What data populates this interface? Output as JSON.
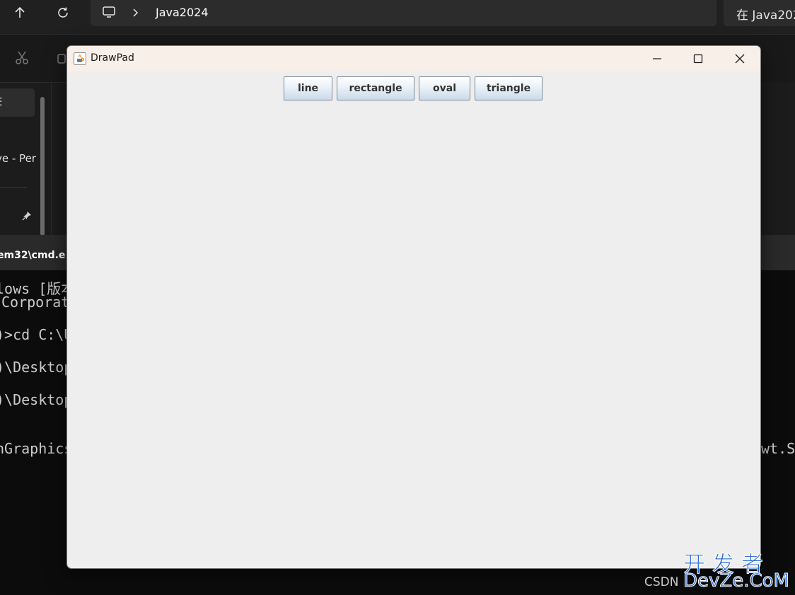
{
  "explorer": {
    "address_path": "Java2024",
    "search_placeholder": "在 Java202",
    "sidebar_text_1": "E",
    "sidebar_text_2": "ve - Per"
  },
  "cmd": {
    "title": "em32\\cmd.e",
    "lines": [
      "lows [版本",
      "Corporat",
      ")>cd C:\\U",
      ")\\Desktop",
      ")\\Desktop",
      "nGraphics"
    ],
    "right_fragment": "wt.Sy"
  },
  "drawpad": {
    "title": "DrawPad",
    "buttons": [
      {
        "label": "line"
      },
      {
        "label": "rectangle"
      },
      {
        "label": "oval"
      },
      {
        "label": "triangle"
      }
    ]
  },
  "watermark": {
    "chinese": "开发者",
    "csdn": "CSDN",
    "site": "DevZe.CoM"
  },
  "colors": {
    "explorer_bg": "#202020",
    "cmd_bg": "#0c0c0c",
    "drawpad_bg": "#eeeeee",
    "drawpad_title_bg": "#f9efe9",
    "watermark_blue": "#2f6fd6"
  },
  "icons": {
    "up": "arrow-up-icon",
    "refresh": "refresh-icon",
    "pc": "monitor-icon",
    "cut": "scissors-icon",
    "pin": "pin-icon",
    "app": "java-app-icon",
    "minimize": "minimize-icon",
    "maximize": "maximize-icon",
    "close": "close-icon"
  }
}
